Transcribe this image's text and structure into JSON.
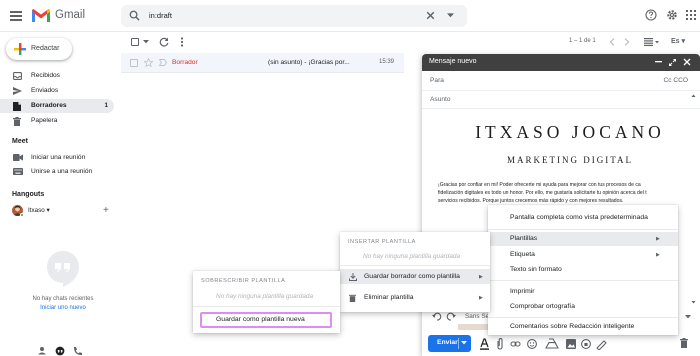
{
  "app": {
    "name": "Gmail"
  },
  "search": {
    "value": "in:draft"
  },
  "sidebar": {
    "compose_label": "Redactar",
    "items": [
      {
        "label": "Recibidos",
        "icon": "inbox-icon"
      },
      {
        "label": "Enviados",
        "icon": "send-icon"
      },
      {
        "label": "Borradores",
        "icon": "draft-icon",
        "count": "1",
        "active": true
      },
      {
        "label": "Papelera",
        "icon": "trash-icon"
      }
    ],
    "meet": {
      "title": "Meet",
      "items": [
        {
          "label": "Iniciar una reunión",
          "icon": "video-icon"
        },
        {
          "label": "Unirse a una reunión",
          "icon": "keyboard-icon"
        }
      ]
    },
    "hangouts": {
      "title": "Hangouts",
      "user": "Itxaso",
      "no_chats": "No hay chats recientes",
      "start_chat": "Iniciar uno nuevo"
    }
  },
  "toolbar": {
    "pagination": "1 – 1 de 1",
    "lang": "Es"
  },
  "email_list": [
    {
      "sender": "Borrador",
      "subject": "(sin asunto) - ¡Gracias por...",
      "time": "15:39"
    }
  ],
  "compose": {
    "title": "Mensaje nuevo",
    "to_label": "Para",
    "cc_label": "Cc CCO",
    "subject_label": "Asunto",
    "signature_name": "ITXASO JOCANO",
    "signature_subtitle": "MARKETING DIGITAL",
    "body_lines": [
      "¡Gracias por confiar en mi! Poder ofrecerte mi ayuda para mejorar con tus procesos de ca",
      "fidelización digitales es todo un honor. Por ello, me gustaría solicitarte tu opinión acerca del t",
      "servicios recibidos. Porque juntos crecemos más rápido y con mejores resultados."
    ],
    "font_label": "Sans Se",
    "send_label": "Enviar"
  },
  "menus": {
    "options": [
      "Pantalla completa como vista predeterminada",
      "Plantillas",
      "Etiqueta",
      "Texto sin formato",
      "Imprimir",
      "Comprobar ortografía",
      "Comentarios sobre Redacción inteligente"
    ],
    "templates": {
      "header": "INSERTAR PLANTILLA",
      "empty": "No hay ninguna plantilla guardada",
      "save_draft": "Guardar borrador como plantilla",
      "delete": "Eliminar plantilla"
    },
    "overwrite": {
      "header": "SOBRESCRIBIR PLANTILLA",
      "empty": "No hay ninguna plantilla guardada",
      "save_new": "Guardar como plantilla nueva"
    }
  },
  "colors": {
    "accent": "#1a73e8",
    "draft_red": "#d93025",
    "highlight": "#df8cf0"
  }
}
